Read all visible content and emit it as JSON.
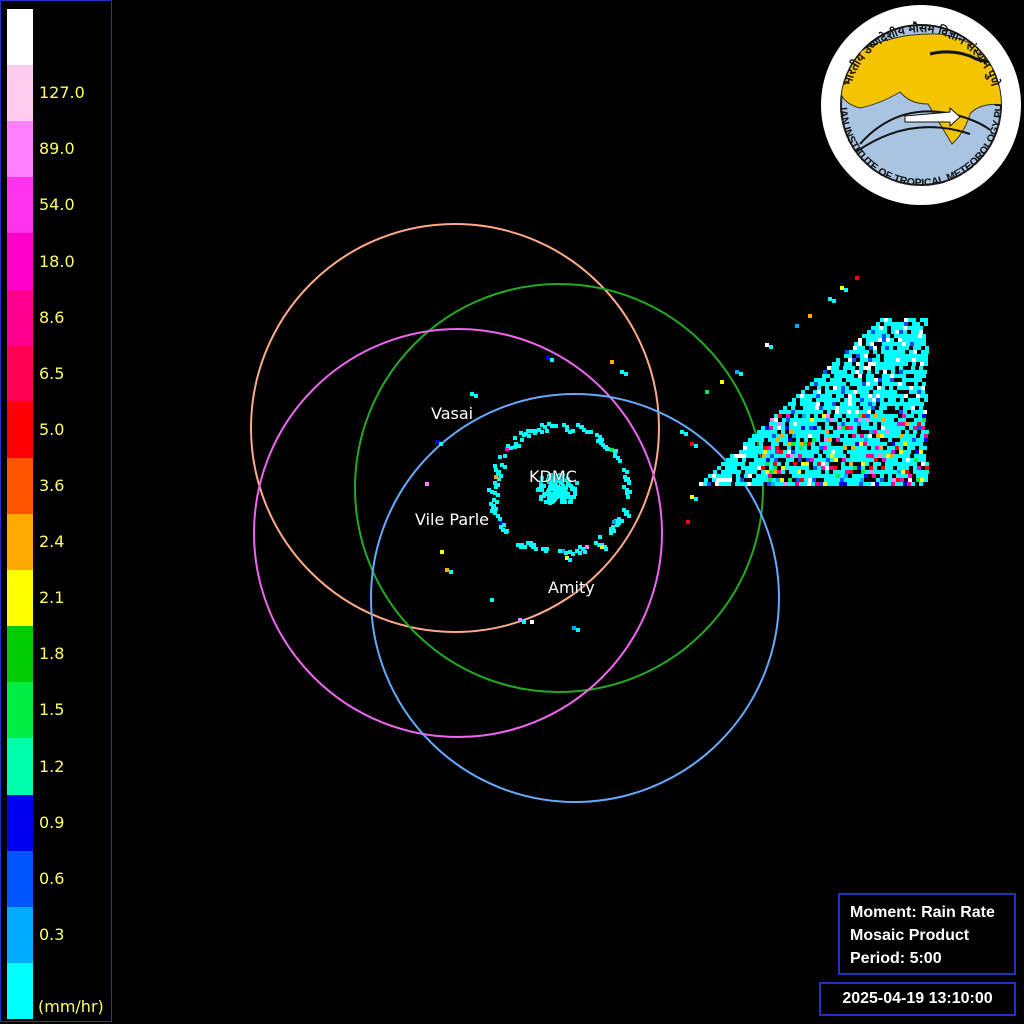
{
  "legend": {
    "unit": "(mm/hr)",
    "levels": [
      {
        "label": "",
        "color": "#ffffff"
      },
      {
        "label": "127.0",
        "color": "#ffccf0"
      },
      {
        "label": "89.0",
        "color": "#ff80ff"
      },
      {
        "label": "54.0",
        "color": "#ff33ee"
      },
      {
        "label": "18.0",
        "color": "#ff00c8"
      },
      {
        "label": "8.6",
        "color": "#ff0090"
      },
      {
        "label": "6.5",
        "color": "#ff0050"
      },
      {
        "label": "5.0",
        "color": "#ff0000"
      },
      {
        "label": "3.6",
        "color": "#ff5500"
      },
      {
        "label": "2.4",
        "color": "#ffaa00"
      },
      {
        "label": "2.1",
        "color": "#ffff00"
      },
      {
        "label": "1.8",
        "color": "#00cc00"
      },
      {
        "label": "1.5",
        "color": "#00ee44"
      },
      {
        "label": "1.2",
        "color": "#00ffaa"
      },
      {
        "label": "0.9",
        "color": "#0000ee"
      },
      {
        "label": "0.6",
        "color": "#0055ff"
      },
      {
        "label": "0.3",
        "color": "#00aaff"
      },
      {
        "label": "",
        "color": "#00ffff"
      }
    ]
  },
  "stations": {
    "vasai": "Vasai",
    "kdmc": "KDMC",
    "vile_parle": "Vile Parle",
    "amity": "Amity"
  },
  "range_ring_colors": {
    "vasai": "#ffaa88",
    "kdmc": "#22aa22",
    "vile_parle": "#ee66ee",
    "amity": "#66aaff"
  },
  "info": {
    "moment": "Moment: Rain Rate",
    "product": "Mosaic Product",
    "period": "Period: 5:00"
  },
  "timestamp": "2025-04-19 13:10:00",
  "logo": {
    "org_name": "INDIAN INSTITUTE OF TROPICAL METEOROLOGY PUNE",
    "hindi_name": "भारतीय उष्णदेशीय मौसम विज्ञान संस्थान पुणे"
  }
}
